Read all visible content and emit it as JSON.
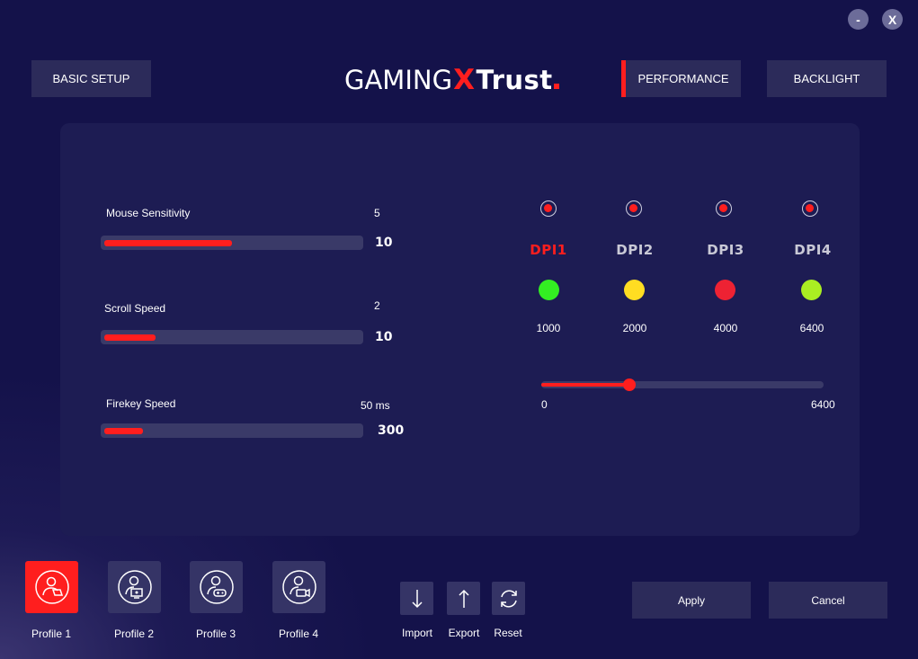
{
  "window": {
    "minimize_label": "-",
    "close_label": "X"
  },
  "nav": {
    "basic_setup": "BASIC SETUP",
    "performance": "PERFORMANCE",
    "backlight": "BACKLIGHT"
  },
  "logo": {
    "gaming": "GAMING",
    "x": "X",
    "trust": "Trust"
  },
  "settings": {
    "mouse_sensitivity": {
      "label": "Mouse Sensitivity",
      "current": "5",
      "max": "10",
      "fraction": 0.5
    },
    "scroll_speed": {
      "label": "Scroll Speed",
      "current": "2",
      "max": "10",
      "fraction": 0.2
    },
    "firekey_speed": {
      "label": "Firekey Speed",
      "current": "50 ms",
      "max": "300",
      "fraction": 0.15
    }
  },
  "dpi": {
    "items": [
      {
        "name": "DPI1",
        "value": "1000",
        "color": "#33ee22",
        "active": true
      },
      {
        "name": "DPI2",
        "value": "2000",
        "color": "#ffdd22",
        "active": false
      },
      {
        "name": "DPI3",
        "value": "4000",
        "color": "#ee2233",
        "active": false
      },
      {
        "name": "DPI4",
        "value": "6400",
        "color": "#aaee22",
        "active": false
      }
    ],
    "slider": {
      "min": "0",
      "max": "6400",
      "value": 2000
    }
  },
  "profiles": [
    {
      "label": "Profile 1",
      "icon": "user-laptop-icon",
      "active": true
    },
    {
      "label": "Profile 2",
      "icon": "user-monitor-icon",
      "active": false
    },
    {
      "label": "Profile 3",
      "icon": "user-gamepad-icon",
      "active": false
    },
    {
      "label": "Profile 4",
      "icon": "user-camera-icon",
      "active": false
    }
  ],
  "tools": {
    "import": "Import",
    "export": "Export",
    "reset": "Reset"
  },
  "actions": {
    "apply": "Apply",
    "cancel": "Cancel"
  },
  "colors": {
    "accent": "#ff1e1e",
    "panel": "#1d1c53",
    "background": "#14124a",
    "button": "#2c2b5a"
  }
}
